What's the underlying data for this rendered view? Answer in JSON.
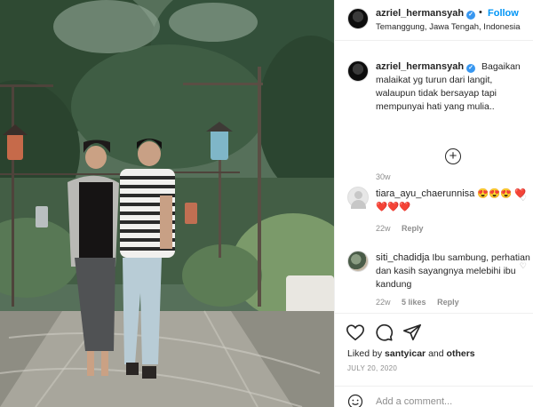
{
  "post": {
    "username": "azriel_hermansyah",
    "follow_label": "Follow",
    "location": "Temanggung, Jawa Tengah, Indonesia",
    "caption": "Bagaikan malaikat yg turun dari langit, walaupun tidak bersayap tapi mempunyai hati yang mulia..",
    "caption_age": "30w",
    "liked_by_prefix": "Liked by",
    "liked_by_user": "santyicar",
    "liked_by_and": "and",
    "liked_by_others": "others",
    "date": "JULY 20, 2020"
  },
  "comments": [
    {
      "username": "tiara_ayu_chaerunnisa",
      "text": "😍😍😍 ❤️❤️❤️❤️",
      "age": "22w",
      "likes": "",
      "reply_label": "Reply"
    },
    {
      "username": "siti_chadidja",
      "text": "Ibu sambung, perhatian dan kasih sayangnya melebihi ibu kandung",
      "age": "22w",
      "likes": "5 likes",
      "reply_label": "Reply"
    }
  ],
  "add_comment": {
    "placeholder": "Add a comment..."
  },
  "icons": {
    "verified": "verified-badge-icon",
    "more": "plus-circle-icon",
    "like": "heart-icon",
    "comment": "comment-icon",
    "share": "paper-plane-icon",
    "emoji": "smiley-icon"
  },
  "colors": {
    "accent": "#0095f6",
    "verified": "#3897f0",
    "muted": "#8e8e8e",
    "text": "#262626"
  }
}
